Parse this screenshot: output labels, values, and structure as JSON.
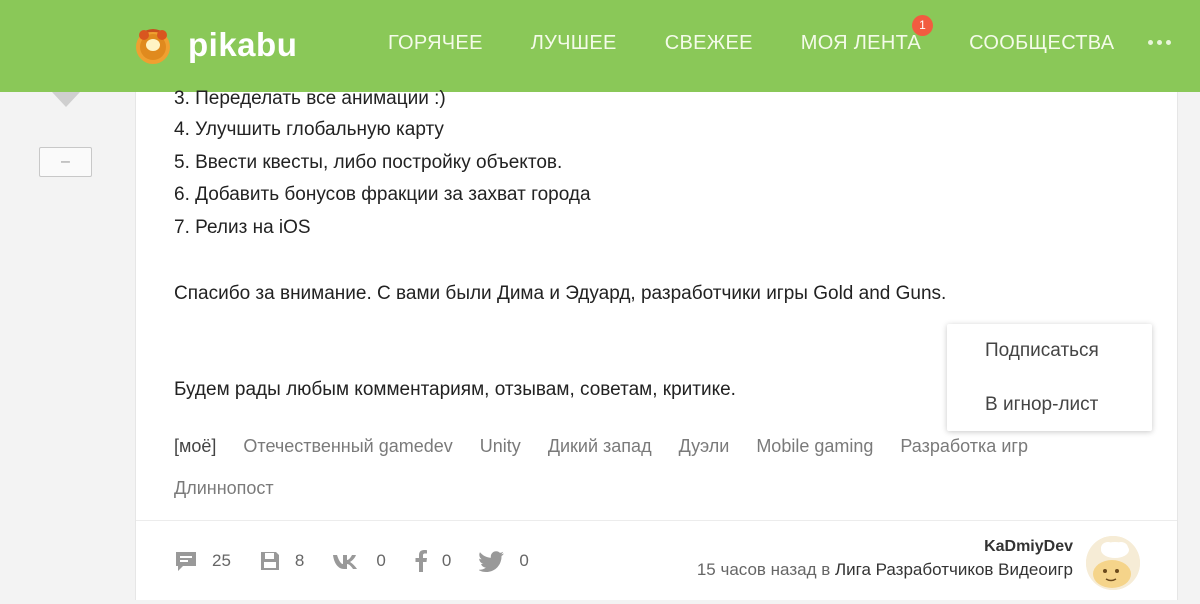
{
  "header": {
    "logo_text": "pikabu",
    "nav": [
      {
        "label": "ГОРЯЧЕЕ"
      },
      {
        "label": "ЛУЧШЕЕ"
      },
      {
        "label": "СВЕЖЕЕ"
      },
      {
        "label": "МОЯ ЛЕНТА",
        "badge": "1"
      },
      {
        "label": "СООБЩЕСТВА"
      }
    ],
    "more_icon": "ellipsis-icon",
    "color": "#8ac858"
  },
  "rating": {
    "down_icon": "arrow-down-icon",
    "minus_label": "–"
  },
  "post": {
    "lines": [
      "3. Переделать все анимации :)",
      "4. Улучшить глобальную карту",
      "5. Ввести квесты, либо постройку объектов.",
      "6. Добавить бонусов фракции за захват города",
      "7. Релиз на iOS"
    ],
    "thanks": "Спасибо за внимание. С вами были Дима и Эдуард, разработчики игры Gold and Guns.",
    "final": "Будем рады любым комментариям, отзывам, советам, критике.",
    "tags": [
      "[моё]",
      "Отечественный gamedev",
      "Unity",
      "Дикий запад",
      "Дуэли",
      "Mobile gaming",
      "Разработка игр",
      "Длиннопост"
    ]
  },
  "footer": {
    "comments": "25",
    "saves": "8",
    "vk": "0",
    "facebook": "0",
    "twitter": "0",
    "author_name": "KaDmiyDev",
    "time": "15 часов назад в",
    "community": "Лига Разработчиков Видеоигр"
  },
  "dropdown": {
    "subscribe": "Подписаться",
    "ignore": "В игнор-лист"
  }
}
